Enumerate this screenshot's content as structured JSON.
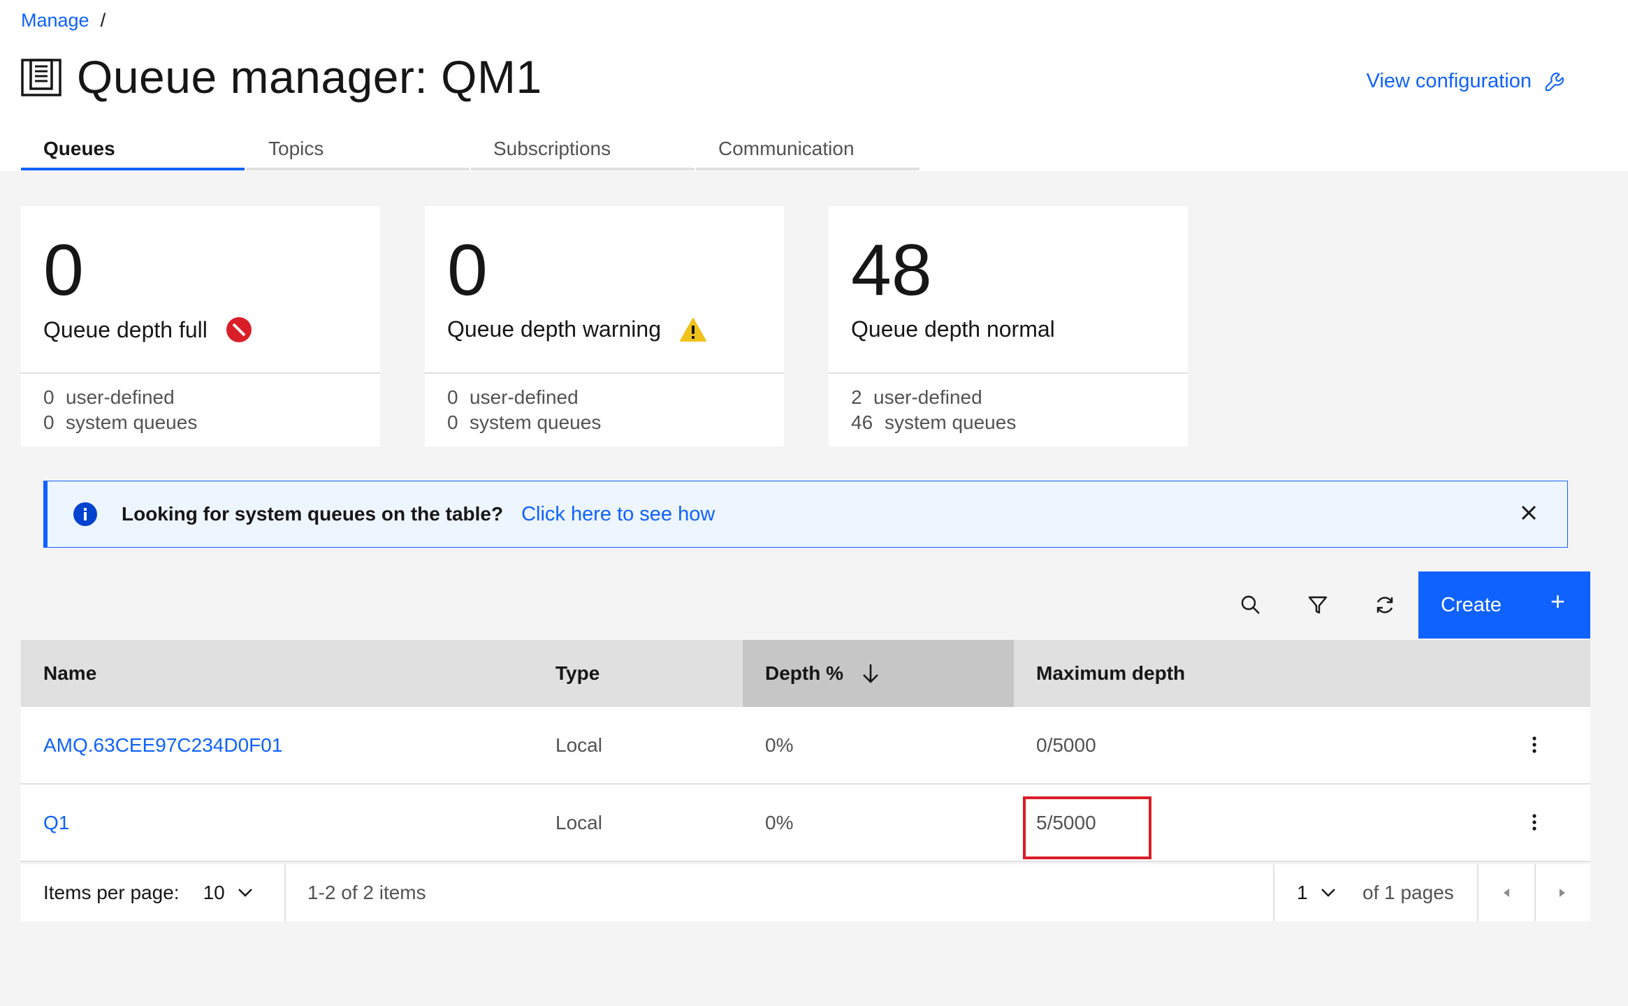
{
  "breadcrumb": {
    "link": "Manage",
    "separator": "/"
  },
  "header": {
    "title": "Queue manager: QM1",
    "view_config": "View configuration"
  },
  "tabs": [
    {
      "label": "Queues",
      "active": true
    },
    {
      "label": "Topics",
      "active": false
    },
    {
      "label": "Subscriptions",
      "active": false
    },
    {
      "label": "Communication",
      "active": false
    }
  ],
  "tiles": [
    {
      "value": "0",
      "label": "Queue depth full",
      "status_icon": "error-icon",
      "user_defined_count": "0",
      "user_defined_label": "user-defined",
      "system_count": "0",
      "system_label": "system queues"
    },
    {
      "value": "0",
      "label": "Queue depth warning",
      "status_icon": "warning-icon",
      "user_defined_count": "0",
      "user_defined_label": "user-defined",
      "system_count": "0",
      "system_label": "system queues"
    },
    {
      "value": "48",
      "label": "Queue depth normal",
      "status_icon": "",
      "user_defined_count": "2",
      "user_defined_label": "user-defined",
      "system_count": "46",
      "system_label": "system queues"
    }
  ],
  "notification": {
    "title": "Looking for system queues on the table?",
    "link": "Click here to see how"
  },
  "toolbar": {
    "create_label": "Create",
    "create_icon": "+"
  },
  "table": {
    "columns": [
      "Name",
      "Type",
      "Depth %",
      "Maximum depth"
    ],
    "sorted_column": "Depth %",
    "rows": [
      {
        "name": "AMQ.63CEE97C234D0F01",
        "type": "Local",
        "depth": "0%",
        "max_depth": "0/5000"
      },
      {
        "name": "Q1",
        "type": "Local",
        "depth": "0%",
        "max_depth": "5/5000"
      }
    ]
  },
  "pagination": {
    "items_per_page_label": "Items per page:",
    "items_per_page": "10",
    "range": "1-2 of 2 items",
    "page": "1",
    "of_pages": "of 1 pages"
  },
  "colors": {
    "accent": "#0f62fe",
    "error": "#da1e28",
    "warning": "#f1c21b"
  }
}
